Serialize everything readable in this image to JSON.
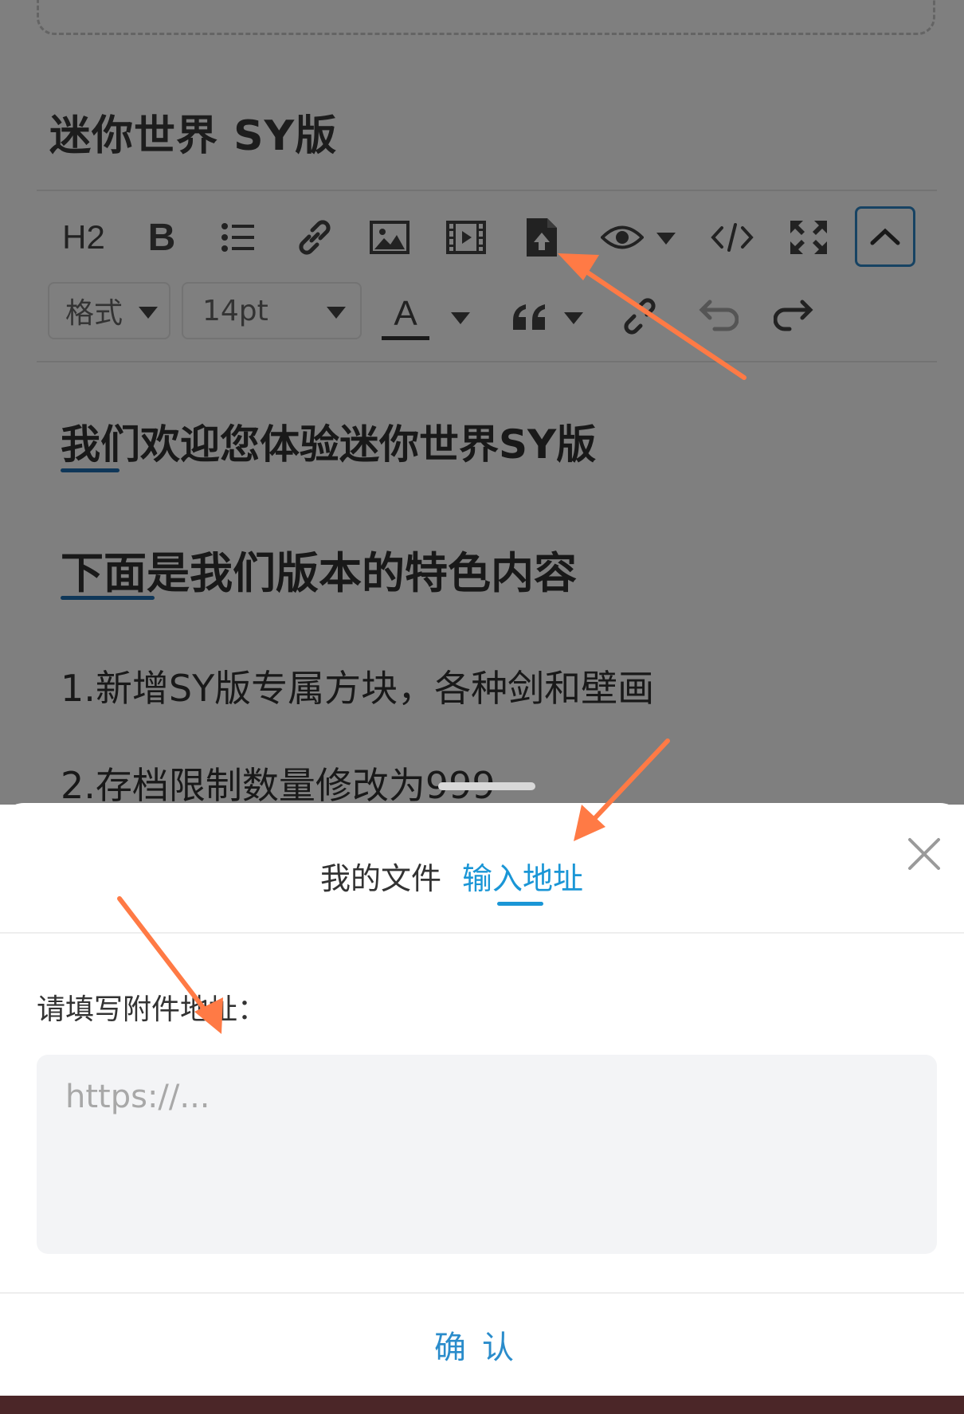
{
  "editor": {
    "title": "迷你世界 SY版",
    "toolbar": {
      "h2_label": "H2",
      "bold_label": "B",
      "format_select": "格式",
      "font_size_select": "14pt",
      "font_color_label": "A"
    },
    "content": [
      "我们欢迎您体验迷你世界SY版",
      "下面是我们版本的特色内容",
      "1.新增SY版专属方块，各种剑和壁画",
      "2.存档限制数量修改为999"
    ]
  },
  "dialog": {
    "tabs": [
      {
        "label": "我的文件",
        "active": false
      },
      {
        "label": "输入地址",
        "active": true
      }
    ],
    "field_label": "请填写附件地址：",
    "url_placeholder": "https://...",
    "url_value": "",
    "confirm_label": "确认"
  },
  "colors": {
    "accent": "#1a96d6",
    "annotation_arrow": "#ff7a45",
    "bottom_bar": "#4b2628"
  }
}
